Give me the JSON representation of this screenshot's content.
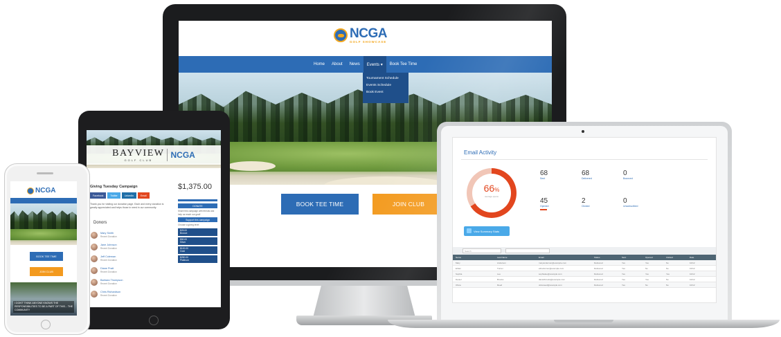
{
  "desktop_site": {
    "logo": {
      "wordmark": "NCGA",
      "tagline": "GOLF SHOWCASE"
    },
    "nav": [
      "Home",
      "About",
      "News",
      "Events ▾",
      "Book Tee Time"
    ],
    "dropdown": [
      "Tournament Schedule",
      "Events Schedule",
      "Book Event"
    ],
    "cta_primary": "BOOK TEE TIME",
    "cta_secondary": "JOIN CLUB"
  },
  "tablet_site": {
    "banner_title": "BAYVIEW",
    "banner_subtitle": "GOLF CLUB",
    "banner_partner": "NCGA",
    "campaign_title": "Giving Tuesday Campaign",
    "amount": "$1,375.00",
    "share_buttons": [
      "Facebook",
      "Twitter",
      "LinkedIn",
      "Email"
    ],
    "intro_text": "Thank you for visiting our donation page. Each and every donation is greatly appreciated and helps those in need in our community.",
    "donors_heading": "Donors",
    "donors": [
      {
        "name": "Mary Smith",
        "sub": "Recent Donation"
      },
      {
        "name": "Jane Johnson",
        "sub": "Recent Donation"
      },
      {
        "name": "Jeff Coleman",
        "sub": "Recent Donation"
      },
      {
        "name": "Diane Pratt",
        "sub": "Recent Donation"
      },
      {
        "name": "Barbara Thompson",
        "sub": "Recent Donation"
      },
      {
        "name": "Chris Richardson",
        "sub": "Recent Donation"
      }
    ],
    "progress_fraction": 1.0,
    "donate_button": "DONATE",
    "support_text": "Share this campaign with friends and help us reach our goal!",
    "support_button": "Support this campaign",
    "levels_heading": "Choose a giving level",
    "levels": [
      {
        "amount": "$25.00",
        "label": "Bronze"
      },
      {
        "amount": "$50.00",
        "label": "Silver"
      },
      {
        "amount": "$100.00",
        "label": "Gold"
      },
      {
        "amount": "$250.00",
        "label": "Platinum"
      }
    ]
  },
  "phone_site": {
    "logo": "NCGA",
    "btn_primary": "BOOK TEE TIME",
    "btn_secondary": "JOIN CLUB",
    "caption": "I DON'T THINK ANYONE KNOWS THE RESPONSIBILITIES TO BE A PART OF THIS... THE COMMUNITY"
  },
  "laptop_app": {
    "title": "Email Activity",
    "donut": {
      "percent": "66",
      "unit": "%",
      "label": "average opens",
      "value_fraction": 0.66
    },
    "stats": [
      {
        "num": "68",
        "label": "Sent"
      },
      {
        "num": "68",
        "label": "Delivered"
      },
      {
        "num": "0",
        "label": "Bounced"
      },
      {
        "num": "45",
        "label": "Opened"
      },
      {
        "num": "2",
        "label": "Clicked"
      },
      {
        "num": "0",
        "label": "Unsubscribed"
      }
    ],
    "button": "View Summary Stats",
    "search_placeholder": "Search",
    "table_headers": [
      "Name",
      "Last Name",
      "Email",
      "Status",
      "Sent",
      "Opened",
      "Clicked",
      "Date"
    ],
    "table_rows": [
      [
        "Mary",
        "Anderson",
        "maryanderson@example.com",
        "Delivered",
        "Yes",
        "Yes",
        "No",
        "10/12"
      ],
      [
        "Ethan",
        "Turner",
        "ethanturner@example.com",
        "Delivered",
        "Yes",
        "No",
        "No",
        "10/12"
      ],
      [
        "Sophia",
        "Lee",
        "sophialee@example.com",
        "Delivered",
        "Yes",
        "Yes",
        "Yes",
        "10/12"
      ],
      [
        "Daniel",
        "Brooks",
        "danielbrooks@example.com",
        "Delivered",
        "Yes",
        "Yes",
        "No",
        "10/12"
      ],
      [
        "Olivia",
        "Reed",
        "oliviareed@example.com",
        "Delivered",
        "Yes",
        "No",
        "No",
        "10/12"
      ]
    ]
  }
}
